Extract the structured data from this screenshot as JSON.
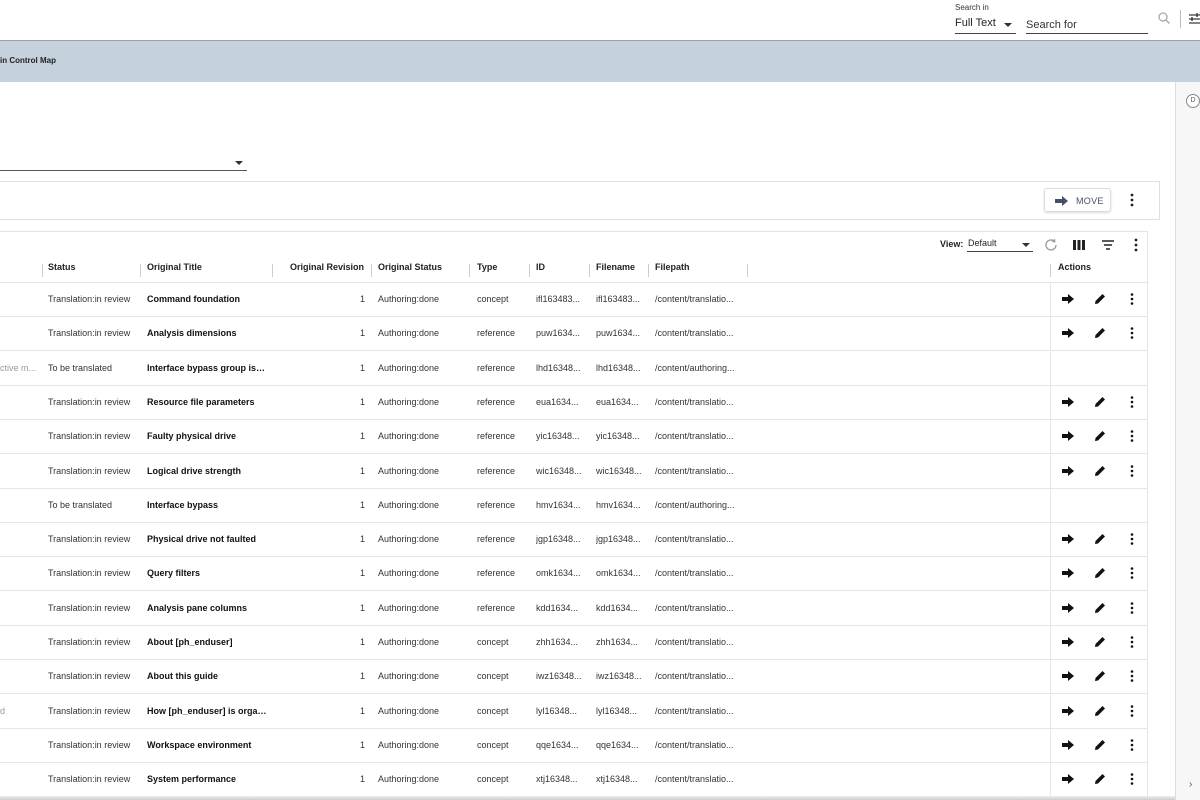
{
  "topbar": {
    "search_in_label": "Search in",
    "search_in_value": "Full Text",
    "search_placeholder": "Search for"
  },
  "breadcrumb": {
    "text": "in Control Map"
  },
  "side_panel": {
    "toggle_label": "D"
  },
  "action_bar": {
    "move_label": "MOVE"
  },
  "table_toolbar": {
    "view_label": "View:",
    "view_value": "Default"
  },
  "columns": {
    "status": "Status",
    "original_title": "Original Title",
    "original_revision": "Original Revision",
    "original_status": "Original Status",
    "type": "Type",
    "id": "ID",
    "filename": "Filename",
    "filepath": "Filepath",
    "actions": "Actions"
  },
  "rows": [
    {
      "lead": "",
      "status": "Translation:in review",
      "title": "Command foundation",
      "revision": "1",
      "orig_status": "Authoring:done",
      "type": "concept",
      "id": "ifl163483...",
      "filename": "ifl163483...",
      "filepath": "/content/translatio...",
      "actions": true
    },
    {
      "lead": "",
      "status": "Translation:in review",
      "title": "Analysis dimensions",
      "revision": "1",
      "orig_status": "Authoring:done",
      "type": "reference",
      "id": "puw1634...",
      "filename": "puw1634...",
      "filepath": "/content/translatio...",
      "actions": true
    },
    {
      "lead": "ctive m...",
      "status": "To be translated",
      "title": "Interface bypass group is i...",
      "revision": "1",
      "orig_status": "Authoring:done",
      "type": "reference",
      "id": "lhd16348...",
      "filename": "lhd16348...",
      "filepath": "/content/authoring...",
      "actions": false
    },
    {
      "lead": "",
      "status": "Translation:in review",
      "title": "Resource file parameters",
      "revision": "1",
      "orig_status": "Authoring:done",
      "type": "reference",
      "id": "eua1634...",
      "filename": "eua1634...",
      "filepath": "/content/translatio...",
      "actions": true
    },
    {
      "lead": "",
      "status": "Translation:in review",
      "title": "Faulty physical drive",
      "revision": "1",
      "orig_status": "Authoring:done",
      "type": "reference",
      "id": "yic16348...",
      "filename": "yic16348...",
      "filepath": "/content/translatio...",
      "actions": true
    },
    {
      "lead": "",
      "status": "Translation:in review",
      "title": "Logical drive strength",
      "revision": "1",
      "orig_status": "Authoring:done",
      "type": "reference",
      "id": "wic16348...",
      "filename": "wic16348...",
      "filepath": "/content/translatio...",
      "actions": true
    },
    {
      "lead": "",
      "status": "To be translated",
      "title": "Interface bypass",
      "revision": "1",
      "orig_status": "Authoring:done",
      "type": "reference",
      "id": "hmv1634...",
      "filename": "hmv1634...",
      "filepath": "/content/authoring...",
      "actions": false
    },
    {
      "lead": "",
      "status": "Translation:in review",
      "title": "Physical drive not faulted",
      "revision": "1",
      "orig_status": "Authoring:done",
      "type": "reference",
      "id": "jgp16348...",
      "filename": "jgp16348...",
      "filepath": "/content/translatio...",
      "actions": true
    },
    {
      "lead": "",
      "status": "Translation:in review",
      "title": "Query filters",
      "revision": "1",
      "orig_status": "Authoring:done",
      "type": "reference",
      "id": "omk1634...",
      "filename": "omk1634...",
      "filepath": "/content/translatio...",
      "actions": true
    },
    {
      "lead": "",
      "status": "Translation:in review",
      "title": "Analysis pane columns",
      "revision": "1",
      "orig_status": "Authoring:done",
      "type": "reference",
      "id": "kdd1634...",
      "filename": "kdd1634...",
      "filepath": "/content/translatio...",
      "actions": true
    },
    {
      "lead": "",
      "status": "Translation:in review",
      "title": "About [ph_enduser]",
      "revision": "1",
      "orig_status": "Authoring:done",
      "type": "concept",
      "id": "zhh1634...",
      "filename": "zhh1634...",
      "filepath": "/content/translatio...",
      "actions": true
    },
    {
      "lead": "",
      "status": "Translation:in review",
      "title": "About this guide",
      "revision": "1",
      "orig_status": "Authoring:done",
      "type": "concept",
      "id": "iwz16348...",
      "filename": "iwz16348...",
      "filepath": "/content/translatio...",
      "actions": true
    },
    {
      "lead": "d",
      "status": "Translation:in review",
      "title": "How [ph_enduser] is organi...",
      "revision": "1",
      "orig_status": "Authoring:done",
      "type": "concept",
      "id": "lyl16348...",
      "filename": "lyl16348...",
      "filepath": "/content/translatio...",
      "actions": true
    },
    {
      "lead": "",
      "status": "Translation:in review",
      "title": "Workspace environment",
      "revision": "1",
      "orig_status": "Authoring:done",
      "type": "concept",
      "id": "qqe1634...",
      "filename": "qqe1634...",
      "filepath": "/content/translatio...",
      "actions": true
    },
    {
      "lead": "",
      "status": "Translation:in review",
      "title": "System performance",
      "revision": "1",
      "orig_status": "Authoring:done",
      "type": "concept",
      "id": "xtj16348...",
      "filename": "xtj16348...",
      "filepath": "/content/translatio...",
      "actions": true
    }
  ],
  "icons": {
    "search": "search-icon",
    "filter_settings": "sliders-icon",
    "move": "arrow-right-icon",
    "more": "more-vert-icon",
    "refresh": "refresh-icon",
    "columns": "columns-icon",
    "filter": "filter-icon",
    "edit": "pencil-icon"
  },
  "colors": {
    "breadcrumb_bg": "#c6d1de",
    "move_text": "#44506b"
  }
}
